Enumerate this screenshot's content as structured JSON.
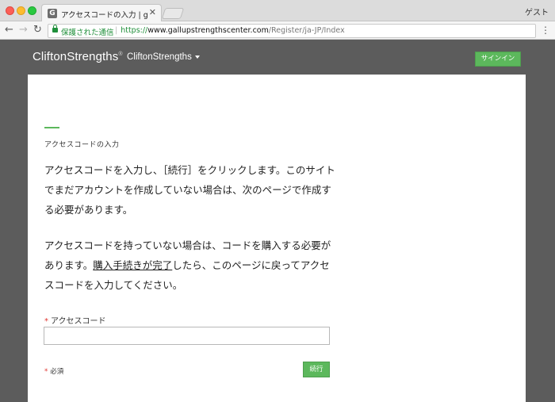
{
  "browser": {
    "tab_favicon": "G",
    "tab_title": "アクセスコードの入力 | gallupstr",
    "close_glyph": "✕",
    "profile": "ゲスト",
    "secure_label": "保護された通信",
    "url_scheme": "https://",
    "url_host": "www.gallupstrengthscenter.com",
    "url_path": "/Register/ja-JP/Index",
    "icons": [
      "back-arrow-icon",
      "forward-arrow-icon",
      "reload-icon",
      "lock-icon",
      "menu-dots-icon"
    ]
  },
  "header": {
    "logo": "CliftonStrengths",
    "logo_mark": "®",
    "nav_label": "CliftonStrengths",
    "signin_label": "サインイン",
    "accent_color": "#5cb85c"
  },
  "main": {
    "section_label": "アクセスコードの入力",
    "paragraph1": "アクセスコードを入力し、［続行］をクリックします。このサイトでまだアカウントを作成していない場合は、次のページで作成する必要があります。",
    "paragraph2_before": "アクセスコードを持っていない場合は、コードを購入する必要があります。",
    "paragraph2_link": "購入手続きが完了",
    "paragraph2_after": "したら、このページに戻ってアクセスコードを入力してください。",
    "field_label": "アクセスコード",
    "field_value": "",
    "required_mark": "*",
    "required_note": "必須",
    "continue_label": "続行"
  }
}
